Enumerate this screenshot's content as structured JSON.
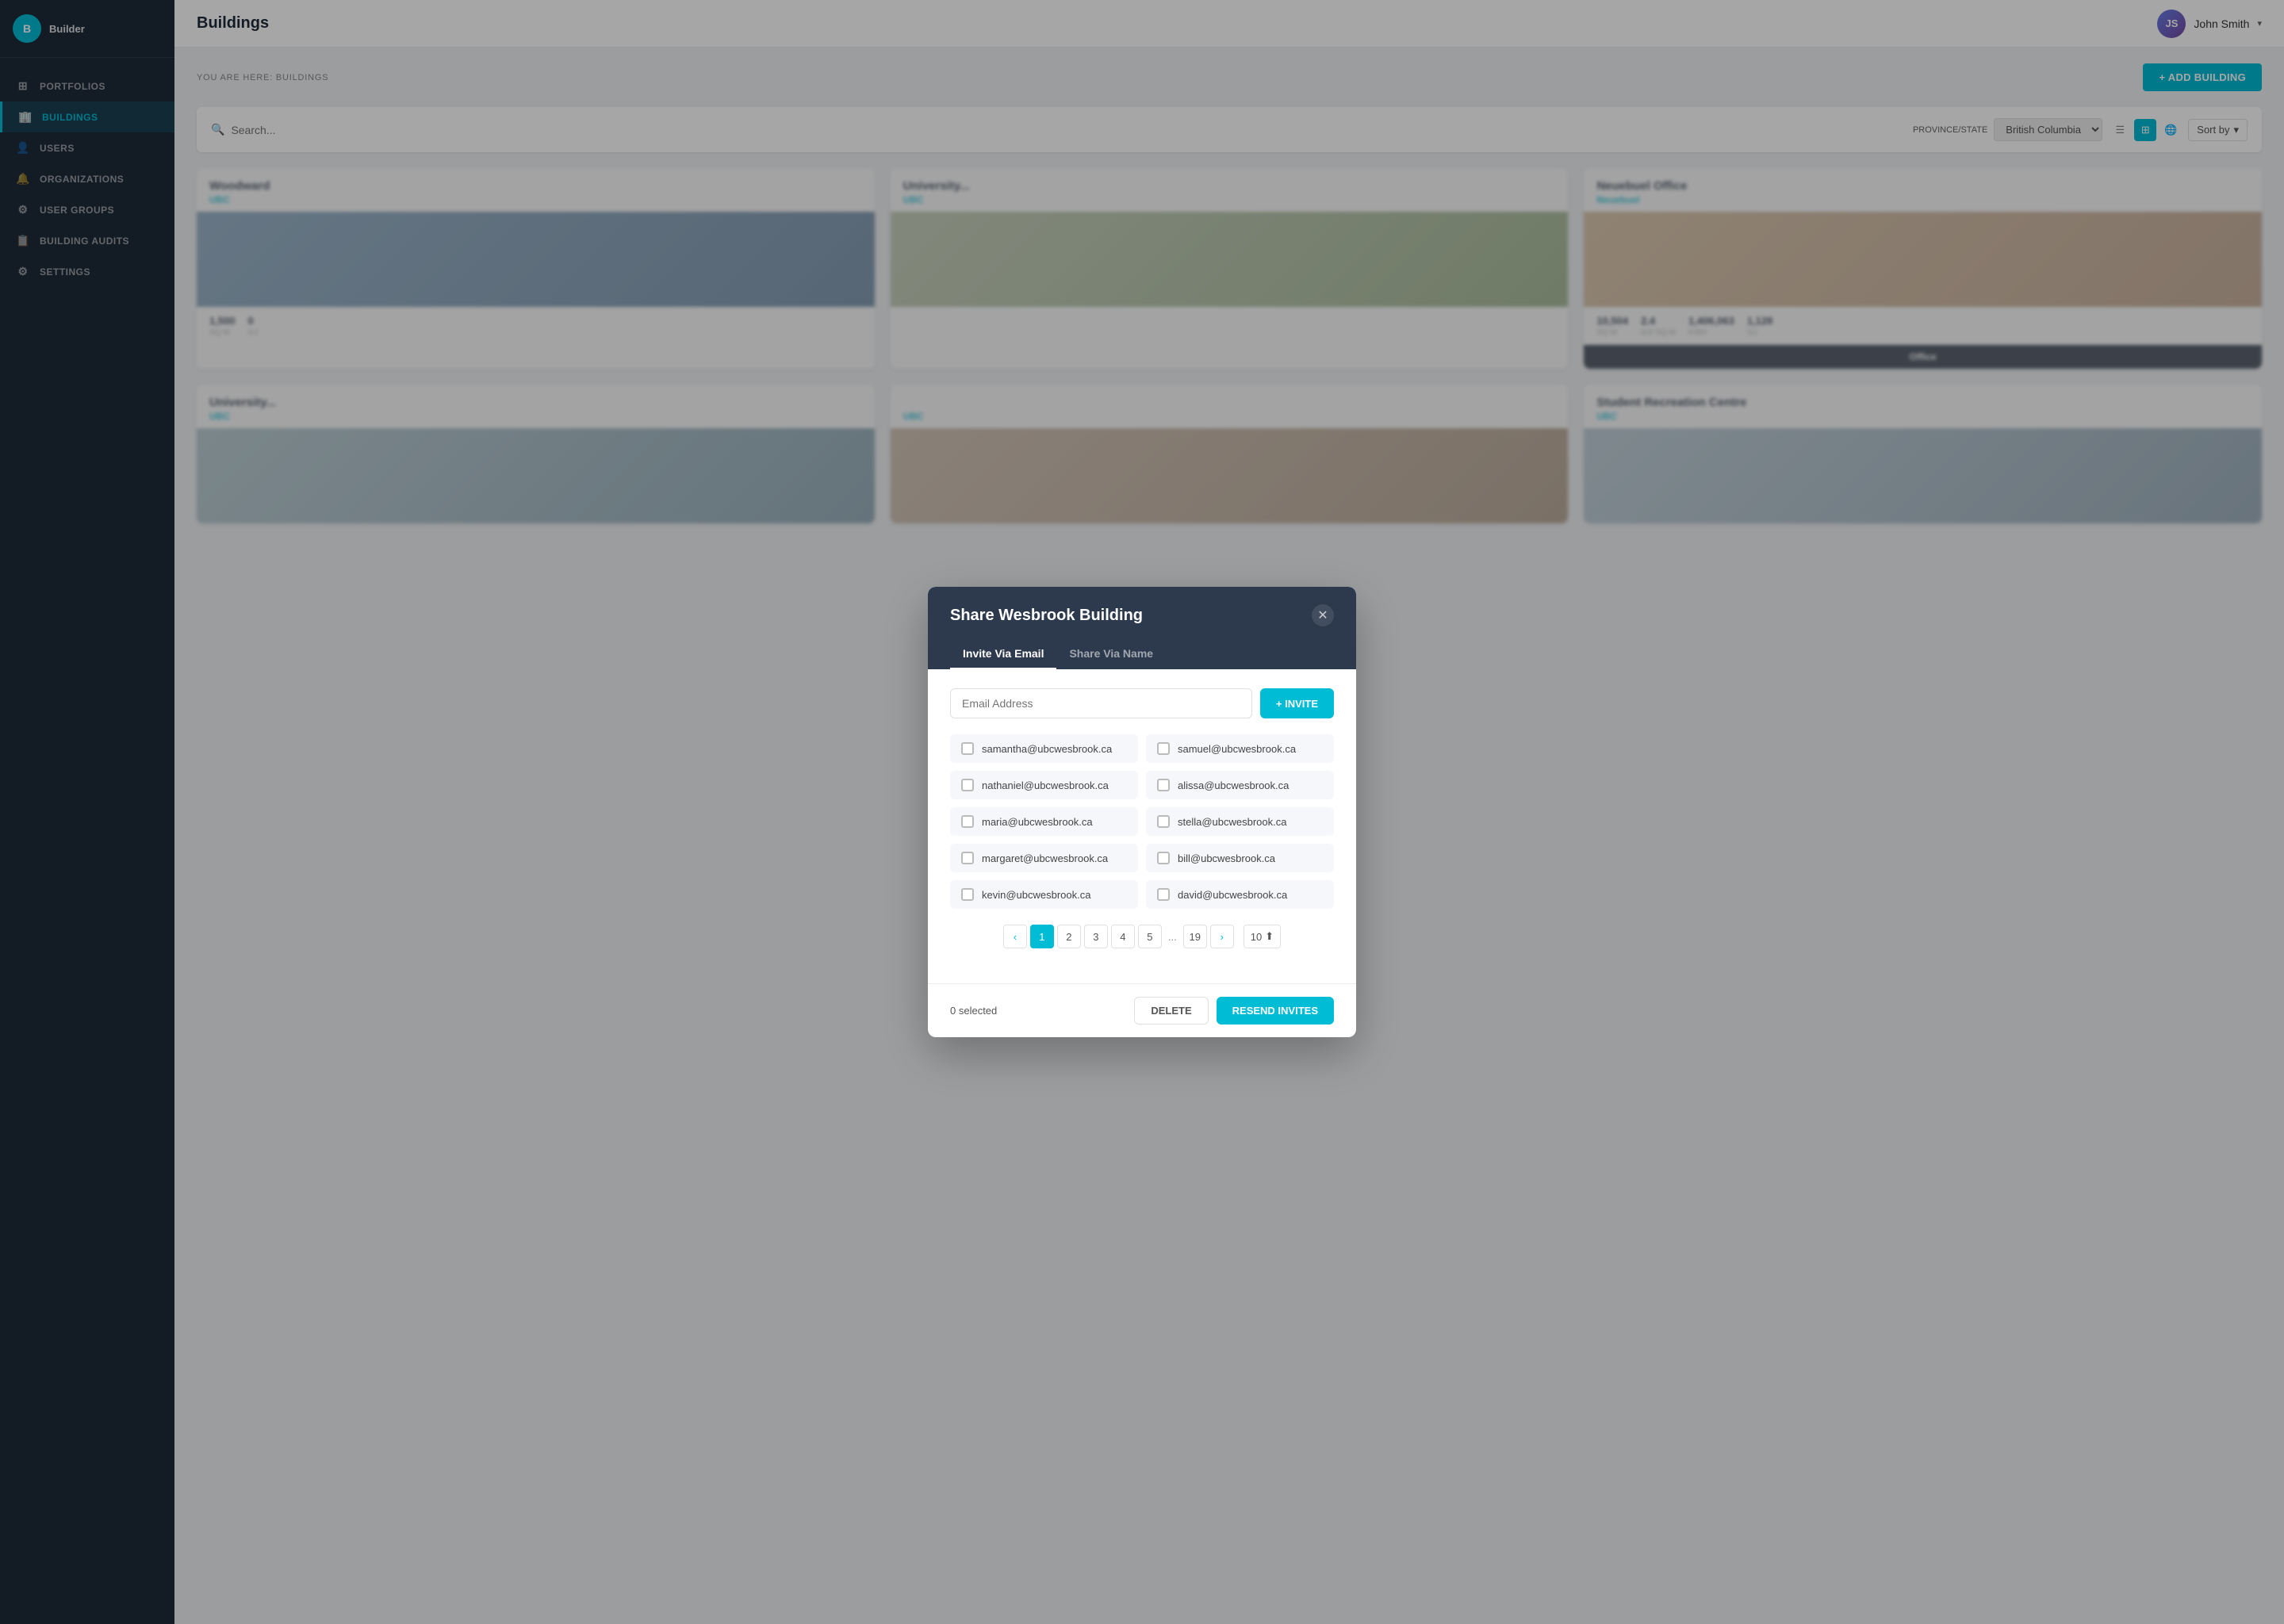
{
  "app": {
    "logo_initial": "B",
    "logo_text": "Builder"
  },
  "sidebar": {
    "items": [
      {
        "id": "portfolios",
        "label": "PORTFOLIOS",
        "icon": "⊞"
      },
      {
        "id": "buildings",
        "label": "BUILDINGS",
        "icon": "🏢",
        "active": true
      },
      {
        "id": "users",
        "label": "USERS",
        "icon": "👤"
      },
      {
        "id": "organizations",
        "label": "ORGANIZATIONS",
        "icon": "🔔"
      },
      {
        "id": "user-groups",
        "label": "USER GROUPS",
        "icon": "⚙"
      },
      {
        "id": "building-audits",
        "label": "BUILDING AUDITS",
        "icon": "📋"
      },
      {
        "id": "settings",
        "label": "SETTINGS",
        "icon": "⚙"
      }
    ]
  },
  "header": {
    "title": "Buildings",
    "user": {
      "name": "John Smith",
      "initials": "JS"
    }
  },
  "breadcrumb": {
    "text": "YOU ARE HERE: BUILDINGS"
  },
  "toolbar": {
    "add_building_label": "+ ADD BUILDING",
    "search_placeholder": "Search...",
    "sort_label": "Sort by"
  },
  "modal": {
    "title": "Share Wesbrook Building",
    "tabs": [
      {
        "id": "invite-email",
        "label": "Invite Via Email",
        "active": true
      },
      {
        "id": "share-name",
        "label": "Share Via Name"
      }
    ],
    "email_placeholder": "Email Address",
    "invite_btn": "+ INVITE",
    "emails": [
      {
        "id": 1,
        "email": "samantha@ubcwesbrook.ca",
        "checked": false
      },
      {
        "id": 2,
        "email": "samuel@ubcwesbrook.ca",
        "checked": false
      },
      {
        "id": 3,
        "email": "nathaniel@ubcwesbrook.ca",
        "checked": false
      },
      {
        "id": 4,
        "email": "alissa@ubcwesbrook.ca",
        "checked": false
      },
      {
        "id": 5,
        "email": "maria@ubcwesbrook.ca",
        "checked": false
      },
      {
        "id": 6,
        "email": "stella@ubcwesbrook.ca",
        "checked": false
      },
      {
        "id": 7,
        "email": "margaret@ubcwesbrook.ca",
        "checked": false
      },
      {
        "id": 8,
        "email": "bill@ubcwesbrook.ca",
        "checked": false
      },
      {
        "id": 9,
        "email": "kevin@ubcwesbrook.ca",
        "checked": false
      },
      {
        "id": 10,
        "email": "david@ubcwesbrook.ca",
        "checked": false
      }
    ],
    "pagination": {
      "current": 1,
      "pages": [
        1,
        2,
        3,
        4,
        5
      ],
      "last": 19,
      "per_page": 10
    },
    "footer": {
      "selected_count": "0 selected",
      "delete_label": "DELETE",
      "resend_label": "RESEND INVITES"
    }
  },
  "buildings": [
    {
      "name": "Woodward",
      "org": "UBC",
      "stats": [
        {
          "value": "1,500",
          "unit": "SQ M"
        },
        {
          "value": "0",
          "unit": "GJ"
        }
      ],
      "img_color": "#7a9cb8"
    },
    {
      "name": "University...",
      "org": "UBC",
      "stats": [],
      "img_color": "#c4a882"
    },
    {
      "name": "Neuebuel Office",
      "org": "Neuebuel",
      "stats": [
        {
          "value": "10,504",
          "unit": "SQ M"
        },
        {
          "value": "2.4",
          "unit": "GJ/ SQ M"
        },
        {
          "value": "1,406,063",
          "unit": "KWH"
        },
        {
          "value": "1,128",
          "unit": "GJ"
        }
      ],
      "footer": "Office",
      "img_color": "#d4b896"
    },
    {
      "name": "Student Recreation Centre",
      "org": "UBC",
      "stats": [],
      "img_color": "#a0b4c8"
    }
  ]
}
